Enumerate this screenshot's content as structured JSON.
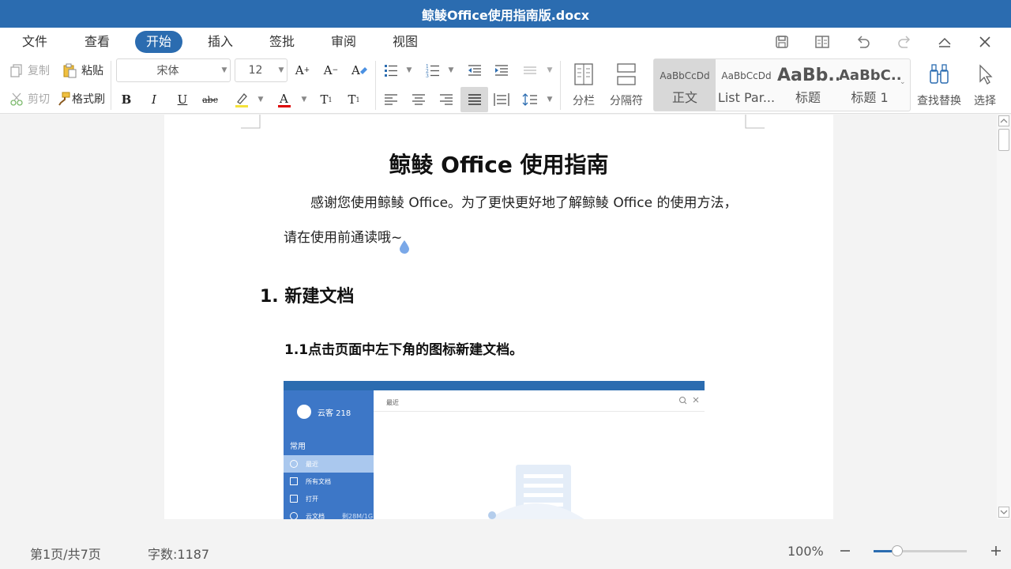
{
  "window": {
    "title": "鲸鲮Office使用指南版.docx"
  },
  "menu": {
    "tabs": [
      "文件",
      "查看",
      "开始",
      "插入",
      "签批",
      "审阅",
      "视图"
    ],
    "active_tab": "开始"
  },
  "ribbon": {
    "copy": "复制",
    "paste": "粘贴",
    "cut": "剪切",
    "format_painter": "格式刷",
    "font_family": "宋体",
    "font_size": "12",
    "columns": "分栏",
    "separator": "分隔符",
    "styles": [
      {
        "preview": "AaBbCcDd",
        "name": "正文"
      },
      {
        "preview": "AaBbCcDd",
        "name": "List Par..."
      },
      {
        "preview": "AaBb...",
        "name": "标题"
      },
      {
        "preview": "AaBbC...",
        "name": "标题 1"
      }
    ],
    "find_replace": "查找替换",
    "select": "选择"
  },
  "document": {
    "title": "鲸鲮 Office 使用指南",
    "intro_line1": "感谢您使用鲸鲮 Office。为了更快更好地了解鲸鲮 Office 的使用方法，",
    "intro_line2": "请在使用前通读哦~",
    "heading1": "1. 新建文档",
    "heading2": "1.1点击页面中左下角的图标新建文档。",
    "embedded_image": {
      "user": "云客 218",
      "section": "常用",
      "items": [
        "最近",
        "所有文档",
        "打开",
        "云文档"
      ],
      "item_extra": "剩28M/1G",
      "header": "最近"
    }
  },
  "status": {
    "page": "第1页/共7页",
    "word_count": "字数:1187",
    "zoom": "100%",
    "zoom_level": 0.25
  },
  "colors": {
    "accent": "#2b6cb0",
    "title_bar": "#2b6cb0"
  }
}
